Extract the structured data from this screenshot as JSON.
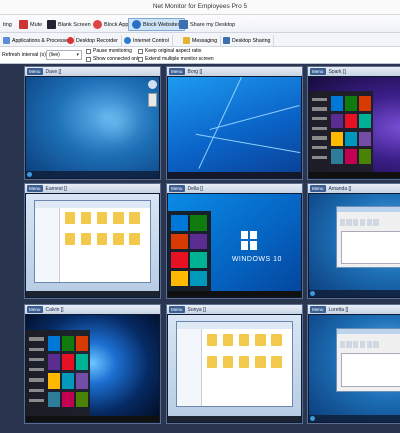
{
  "app": {
    "title": "Net Monitor for Employees Pro 5"
  },
  "toolbar": {
    "items": [
      {
        "label": "ting",
        "icon": "broadcast-icon"
      },
      {
        "label": "Mute",
        "icon": "speaker-icon"
      },
      {
        "label": "Blank Screen",
        "icon": "screen-icon"
      },
      {
        "label": "Block Apps",
        "icon": "block-apps-icon"
      },
      {
        "label": "Block Websites",
        "icon": "block-websites-icon"
      },
      {
        "label": "Share my Desktop",
        "icon": "share-desktop-icon"
      }
    ]
  },
  "tabs": [
    {
      "label": "Applications & Processes",
      "icon": "apps-icon"
    },
    {
      "label": "Desktop Recorder",
      "icon": "recorder-icon"
    },
    {
      "label": "Internet Control",
      "icon": "internet-icon"
    },
    {
      "label": "Messaging",
      "icon": "message-icon"
    },
    {
      "label": "Desktop Sharing",
      "icon": "sharing-icon"
    }
  ],
  "options": {
    "refresh_label": "Refresh interval (s):",
    "refresh_value": "(live)",
    "pause": "Pause monitoring",
    "show_connected": "Show connected only",
    "keep_aspect": "Keep original aspect ratio",
    "extend_multi": "Extend multiple monitor screen"
  },
  "menu_label": "Menu",
  "computers": [
    {
      "name": "",
      "theme": "w7"
    },
    {
      "name": "Dave []",
      "theme": "w7"
    },
    {
      "name": "Borg []",
      "theme": "w10blue"
    },
    {
      "name": "Spark []",
      "theme": "w10start"
    },
    {
      "name": "",
      "theme": "w7"
    },
    {
      "name": "Earnest []",
      "theme": "explorer"
    },
    {
      "name": "Della []",
      "theme": "w10logo"
    },
    {
      "name": "Amanda []",
      "theme": "w7dlg"
    },
    {
      "name": "",
      "theme": "w7"
    },
    {
      "name": "Calvin []",
      "theme": "w10dark"
    },
    {
      "name": "Sonya []",
      "theme": "explorer"
    },
    {
      "name": "Loretta []",
      "theme": "w7dlg"
    }
  ],
  "screen_text": {
    "windows10": "WINDOWS 10"
  },
  "colors": {
    "accent": "#3b5f93",
    "grid_bg": "#2a3550",
    "active_tab": "#cfe3f7"
  }
}
